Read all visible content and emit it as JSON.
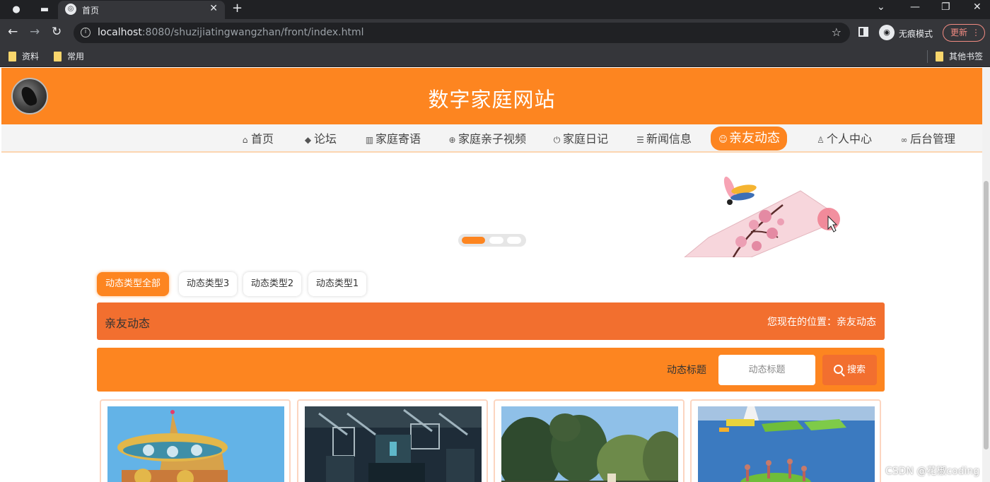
{
  "browser": {
    "tab_title": "首页",
    "url_host": "localhost",
    "url_rest": ":8080/shuzijiatingwangzhan/front/index.html",
    "incognito_label": "无痕模式",
    "update_label": "更新",
    "bookmarks": [
      "资料",
      "常用"
    ],
    "other_bookmarks": "其他书签"
  },
  "site": {
    "title": "数字家庭网站"
  },
  "nav": {
    "items": [
      {
        "label": "首页",
        "icon": "home-icon"
      },
      {
        "label": "论坛",
        "icon": "graduation-cap-icon"
      },
      {
        "label": "家庭寄语",
        "icon": "columns-icon"
      },
      {
        "label": "家庭亲子视频",
        "icon": "gamepad-icon"
      },
      {
        "label": "家庭日记",
        "icon": "power-icon"
      },
      {
        "label": "新闻信息",
        "icon": "sliders-icon"
      },
      {
        "label": "亲友动态",
        "icon": "smile-icon",
        "active": true
      },
      {
        "label": "个人中心",
        "icon": "user-icon"
      },
      {
        "label": "后台管理",
        "icon": "link-icon"
      }
    ]
  },
  "carousel": {
    "slide_count": 3,
    "active_index": 0
  },
  "filters": [
    "动态类型全部",
    "动态类型3",
    "动态类型2",
    "动态类型1"
  ],
  "breadcrumb": {
    "title": "亲友动态",
    "location": "您现在的位置：亲友动态"
  },
  "search": {
    "label": "动态标题",
    "placeholder": "动态标题",
    "button_label": "搜索"
  },
  "cards": [
    {
      "image": "carousel-photo"
    },
    {
      "image": "dark-interior-photo"
    },
    {
      "image": "trees-landscape-photo"
    },
    {
      "image": "water-park-photo"
    }
  ],
  "watermark": "CSDN @花椒coding",
  "colors": {
    "primary": "#fd8520",
    "secondary": "#f26f2f",
    "nav_bg": "#f4f4f4"
  }
}
